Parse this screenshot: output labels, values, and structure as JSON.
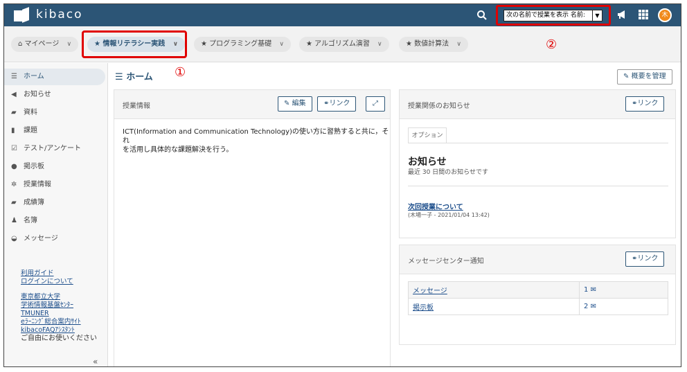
{
  "app": {
    "name": "kibaco"
  },
  "topbar": {
    "name_select_value": "次の名前で授業を表示 名前:"
  },
  "tabs": [
    {
      "label": "マイページ",
      "icon": "home-icon"
    },
    {
      "label": "情報リテラシー実践",
      "icon": "star-icon"
    },
    {
      "label": "プログラミング基礎",
      "icon": "star-icon"
    },
    {
      "label": "アルゴリズム演習",
      "icon": "star-icon"
    },
    {
      "label": "数値計算法",
      "icon": "star-icon"
    }
  ],
  "annotations": {
    "one": "①",
    "two": "②"
  },
  "sidebar": {
    "items": [
      {
        "label": "ホーム",
        "icon": "list-icon"
      },
      {
        "label": "お知らせ",
        "icon": "megaphone-icon"
      },
      {
        "label": "資料",
        "icon": "folder-icon"
      },
      {
        "label": "課題",
        "icon": "file-icon"
      },
      {
        "label": "テスト/アンケート",
        "icon": "check-icon"
      },
      {
        "label": "掲示板",
        "icon": "chat-icon"
      },
      {
        "label": "授業情報",
        "icon": "gear-icon"
      },
      {
        "label": "成績簿",
        "icon": "book-icon"
      },
      {
        "label": "名簿",
        "icon": "users-icon"
      },
      {
        "label": "メッセージ",
        "icon": "inbox-icon"
      }
    ],
    "links_a": [
      "利用ガイド",
      "ログインについて"
    ],
    "links_b": [
      "東京都立大学",
      "学術情報基盤ｾﾝﾀｰ",
      "TMUNER",
      "eﾗｰﾆﾝｸﾞ総合案内ｻｲﾄ",
      "kibacoFAQｱｼｽﾀﾝﾄ"
    ],
    "note": "ご自由にお使いください",
    "collapse_glyph": "«"
  },
  "main": {
    "title": "ホーム",
    "manage_label": "概要を管理",
    "course_info": {
      "title": "授業情報",
      "edit_label": "編集",
      "link_label": "リンク",
      "body_line1": "ICT(Information and Communication Technology)の使い方に習熟すると共に，それ",
      "body_line2": "を活用し具体的な課題解決を行う。"
    },
    "news_panel": {
      "title": "授業関係のお知らせ",
      "link_label": "リンク",
      "option_tab": "オプション",
      "heading": "お知らせ",
      "subheading": "最近 30 日間のお知らせです",
      "item_title": "次回授業について",
      "item_meta": "(木場一子 - 2021/01/04 13:42)"
    },
    "message_panel": {
      "title": "メッセージセンター通知",
      "link_label": "リンク",
      "rows": [
        {
          "label": "メッセージ",
          "count": "1"
        },
        {
          "label": "掲示板",
          "count": "2"
        }
      ]
    }
  }
}
